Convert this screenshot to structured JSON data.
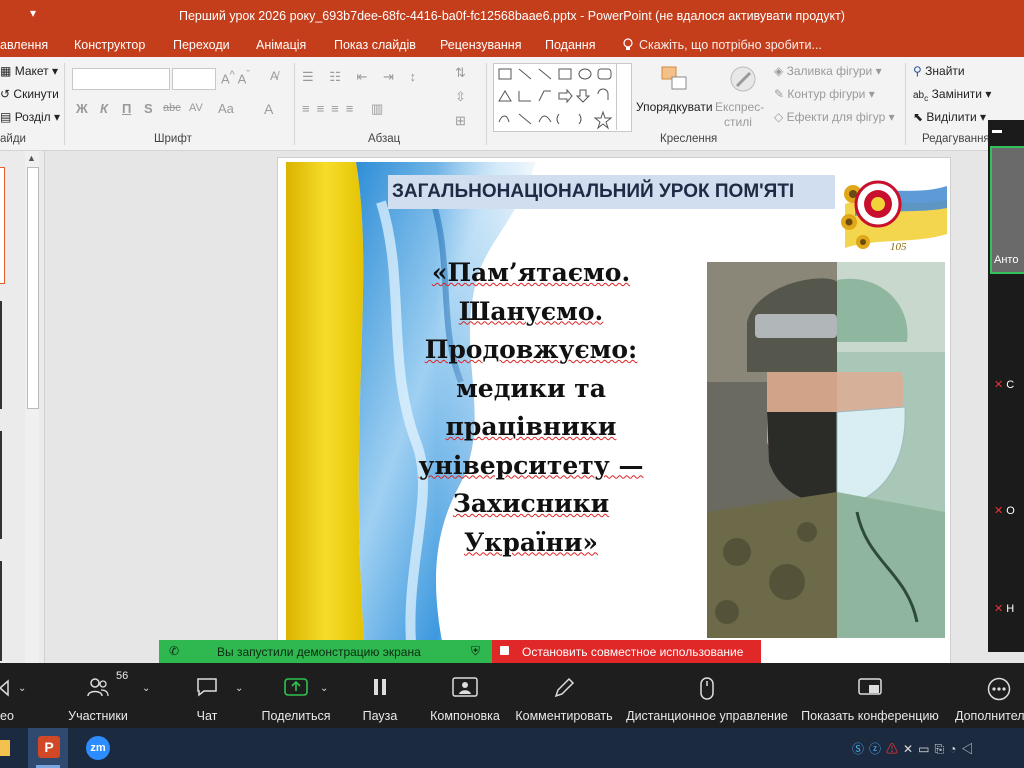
{
  "window": {
    "title": "Перший урок 2026 року_693b7dee-68fc-4416-ba0f-fc12568baae6.pptx - PowerPoint (не вдалося активувати продукт)"
  },
  "ribbon_tabs": [
    "авлення",
    "Конструктор",
    "Переходи",
    "Анімація",
    "Показ слайдів",
    "Рецензування",
    "Подання"
  ],
  "tell_me": "Скажіть, що потрібно зробити...",
  "ribbon": {
    "slides": {
      "layout": "Макет",
      "reset": "Скинути",
      "section": "Розділ",
      "group": "айди"
    },
    "font": {
      "group": "Шрифт",
      "bold": "Ж",
      "italic": "К",
      "underline": "П",
      "shadow": "S",
      "strike": "abc",
      "spacing": "AV",
      "case": "Aa",
      "color": "A"
    },
    "paragraph": {
      "group": "Абзац"
    },
    "drawing": {
      "arrange": "Упорядкувати",
      "quick_styles_1": "Експрес-",
      "quick_styles_2": "стилі",
      "shape_fill": "Заливка фігури",
      "shape_outline": "Контур фігури",
      "shape_effects": "Ефекти для фігур",
      "group": "Креслення"
    },
    "editing": {
      "find": "Знайти",
      "replace": "Замінити",
      "select": "Виділити",
      "group": "Редагування"
    }
  },
  "slide": {
    "title": "ЗАГАЛЬНОНАЦІОНАЛЬНИЙ УРОК ПОМ'ЯТІ",
    "body_lines": [
      "«Пам’ятаємо.",
      "Шануємо.",
      "Продовжуємо:",
      "медики та",
      "працівники",
      "університету —",
      "Захисники",
      "України»"
    ],
    "logo_number": "105"
  },
  "zoom_participants": {
    "name_partial": "Анто",
    "rows": [
      "С",
      "О",
      "Н"
    ]
  },
  "share_banner": {
    "status": "Вы запустили демонстрацию экрана",
    "stop": "Остановить совместное использование"
  },
  "zoom_toolbar": {
    "video_label": "ео",
    "participants_label": "Участники",
    "participants_count": "56",
    "chat_label": "Чат",
    "share_label": "Поделиться",
    "pause_label": "Пауза",
    "layout_label": "Компоновка",
    "annotate_label": "Комментировать",
    "remote_label": "Дистанционное управление",
    "show_meeting_label": "Показать конференцию",
    "more_label": "Дополнител"
  },
  "taskbar": {
    "zoom_app_text": "zm"
  },
  "colors": {
    "powerpoint_red": "#c43e1c",
    "zoom_green": "#2fb84f",
    "zoom_red": "#e02828"
  }
}
